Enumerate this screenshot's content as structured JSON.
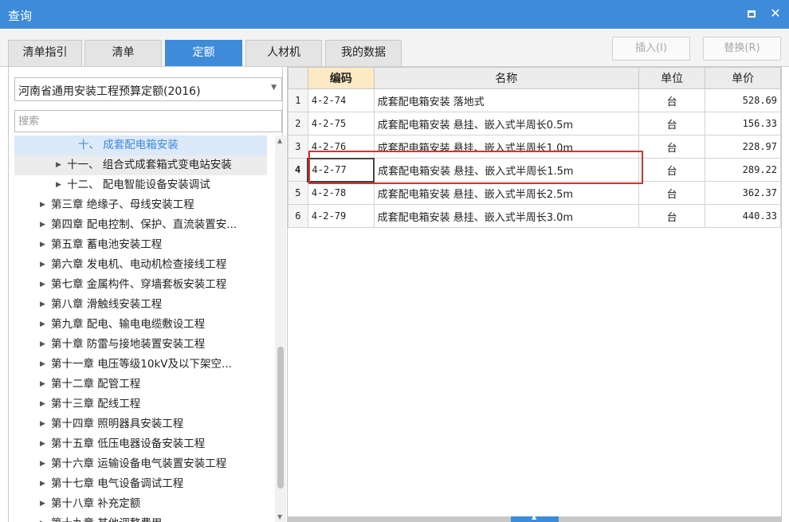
{
  "window": {
    "title": "查询",
    "maximize_icon": "maximize-icon",
    "close_label": "✕"
  },
  "tabs": [
    {
      "label": "清单指引",
      "active": false
    },
    {
      "label": "清单",
      "active": false
    },
    {
      "label": "定额",
      "active": true
    },
    {
      "label": "人材机",
      "active": false
    },
    {
      "label": "我的数据",
      "active": false
    }
  ],
  "toolbar": {
    "insert_label": "插入(I)",
    "replace_label": "替换(R)"
  },
  "left": {
    "selected_quota": "河南省通用安装工程预算定额(2016)",
    "search_placeholder": "搜索",
    "search_value": "",
    "tree": [
      {
        "label": "十、 成套配电箱安装",
        "state": "selected",
        "expanded": null
      },
      {
        "label": "十一、 组合式成套箱式变电站安装",
        "state": "hover",
        "expanded": false
      },
      {
        "label": "十二、 配电智能设备安装调试",
        "state": "",
        "expanded": false
      },
      {
        "label": "第三章 绝缘子、母线安装工程",
        "state": "",
        "expanded": false
      },
      {
        "label": "第四章 配电控制、保护、直流装置安...",
        "state": "",
        "expanded": false
      },
      {
        "label": "第五章 蓄电池安装工程",
        "state": "",
        "expanded": false
      },
      {
        "label": "第六章 发电机、电动机检查接线工程",
        "state": "",
        "expanded": false
      },
      {
        "label": "第七章 金属构件、穿墙套板安装工程",
        "state": "",
        "expanded": false
      },
      {
        "label": "第八章 滑触线安装工程",
        "state": "",
        "expanded": false
      },
      {
        "label": "第九章 配电、输电电缆敷设工程",
        "state": "",
        "expanded": false
      },
      {
        "label": "第十章 防雷与接地装置安装工程",
        "state": "",
        "expanded": false
      },
      {
        "label": "第十一章 电压等级10kV及以下架空...",
        "state": "",
        "expanded": false
      },
      {
        "label": "第十二章 配管工程",
        "state": "",
        "expanded": false
      },
      {
        "label": "第十三章 配线工程",
        "state": "",
        "expanded": false
      },
      {
        "label": "第十四章 照明器具安装工程",
        "state": "",
        "expanded": false
      },
      {
        "label": "第十五章 低压电器设备安装工程",
        "state": "",
        "expanded": false
      },
      {
        "label": "第十六章 运输设备电气装置安装工程",
        "state": "",
        "expanded": false
      },
      {
        "label": "第十七章 电气设备调试工程",
        "state": "",
        "expanded": false
      },
      {
        "label": "第十八章 补充定额",
        "state": "",
        "expanded": false
      },
      {
        "label": "第十九章 其他调整费用",
        "state": "",
        "expanded": false
      }
    ]
  },
  "grid": {
    "columns": [
      "编码",
      "名称",
      "单位",
      "单价"
    ],
    "rows": [
      {
        "num": "1",
        "code": "4-2-74",
        "name": "成套配电箱安装 落地式",
        "unit": "台",
        "price": "528.69"
      },
      {
        "num": "2",
        "code": "4-2-75",
        "name": "成套配电箱安装 悬挂、嵌入式半周长0.5m",
        "unit": "台",
        "price": "156.33"
      },
      {
        "num": "3",
        "code": "4-2-76",
        "name": "成套配电箱安装 悬挂、嵌入式半周长1.0m",
        "unit": "台",
        "price": "228.97"
      },
      {
        "num": "4",
        "code": "4-2-77",
        "name": "成套配电箱安装 悬挂、嵌入式半周长1.5m",
        "unit": "台",
        "price": "289.22"
      },
      {
        "num": "5",
        "code": "4-2-78",
        "name": "成套配电箱安装 悬挂、嵌入式半周长2.5m",
        "unit": "台",
        "price": "362.37"
      },
      {
        "num": "6",
        "code": "4-2-79",
        "name": "成套配电箱安装 悬挂、嵌入式半周长3.0m",
        "unit": "台",
        "price": "440.33"
      }
    ],
    "current_row": "4"
  },
  "colors": {
    "accent": "#3d8bd9",
    "highlight": "#d9312e",
    "code_header": "#fde9c3"
  }
}
